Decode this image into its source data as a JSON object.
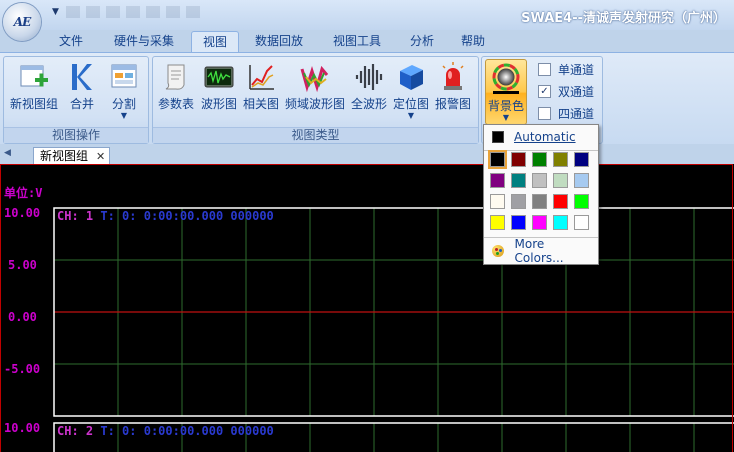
{
  "window": {
    "title": "SWAE4--清诚声发射研究（广州）",
    "logo_text": "AE"
  },
  "menu_tabs": [
    {
      "label": "文件"
    },
    {
      "label": "硬件与采集"
    },
    {
      "label": "视图"
    },
    {
      "label": "数据回放"
    },
    {
      "label": "视图工具"
    },
    {
      "label": "分析"
    },
    {
      "label": "帮助"
    }
  ],
  "ribbon": {
    "groups": {
      "view_ops": {
        "label": "视图操作",
        "buttons": [
          {
            "label": "新视图组",
            "icon": "new-view-group-icon"
          },
          {
            "label": "合并",
            "icon": "merge-icon"
          },
          {
            "label": "分割",
            "icon": "split-icon"
          }
        ]
      },
      "view_types": {
        "label": "视图类型",
        "buttons": [
          {
            "label": "参数表",
            "icon": "parameter-table-icon"
          },
          {
            "label": "波形图",
            "icon": "waveform-icon"
          },
          {
            "label": "相关图",
            "icon": "correlation-icon"
          },
          {
            "label": "频域波形图",
            "icon": "spectrum-icon"
          },
          {
            "label": "全波形",
            "icon": "full-waveform-icon"
          },
          {
            "label": "定位图",
            "icon": "location-icon"
          },
          {
            "label": "报警图",
            "icon": "alarm-icon"
          }
        ]
      },
      "display": {
        "bg_button": {
          "label": "背景色",
          "icon": "background-color-icon"
        },
        "channels": [
          {
            "label": "单通道",
            "checked": false
          },
          {
            "label": "双通道",
            "checked": true
          },
          {
            "label": "四通道",
            "checked": false
          }
        ]
      }
    }
  },
  "doc_tab": {
    "label": "新视图组"
  },
  "plot": {
    "unit_label": "单位:V",
    "y_ticks": [
      "10.00",
      "5.00",
      "0.00",
      "-5.00"
    ],
    "lower_top_tick": "10.00",
    "channels": [
      {
        "ch": "CH:  1",
        "t_label": "T:",
        "time": "0: 0:00:00.000 000000"
      },
      {
        "ch": "CH:  2",
        "t_label": "T:",
        "time": "0: 0:00:00.000 000000"
      }
    ],
    "colors": {
      "grid": "#2e6b2e",
      "zero_line": "#c01010",
      "trace": "#ffffff"
    }
  },
  "color_popup": {
    "automatic_label": "Automatic",
    "more_colors_label": "More Colors...",
    "selected": "#000000",
    "swatches": [
      [
        "#000000",
        "#800000",
        "#008000",
        "#808000",
        "#000080"
      ],
      [
        "#800080",
        "#008080",
        "#c0c0c0",
        "#c0dcc0",
        "#a6caf0"
      ],
      [
        "#fffbf0",
        "#a0a0a4",
        "#808080",
        "#ff0000",
        "#00ff00"
      ],
      [
        "#ffff00",
        "#0000ff",
        "#ff00ff",
        "#00ffff",
        "#ffffff"
      ]
    ]
  }
}
